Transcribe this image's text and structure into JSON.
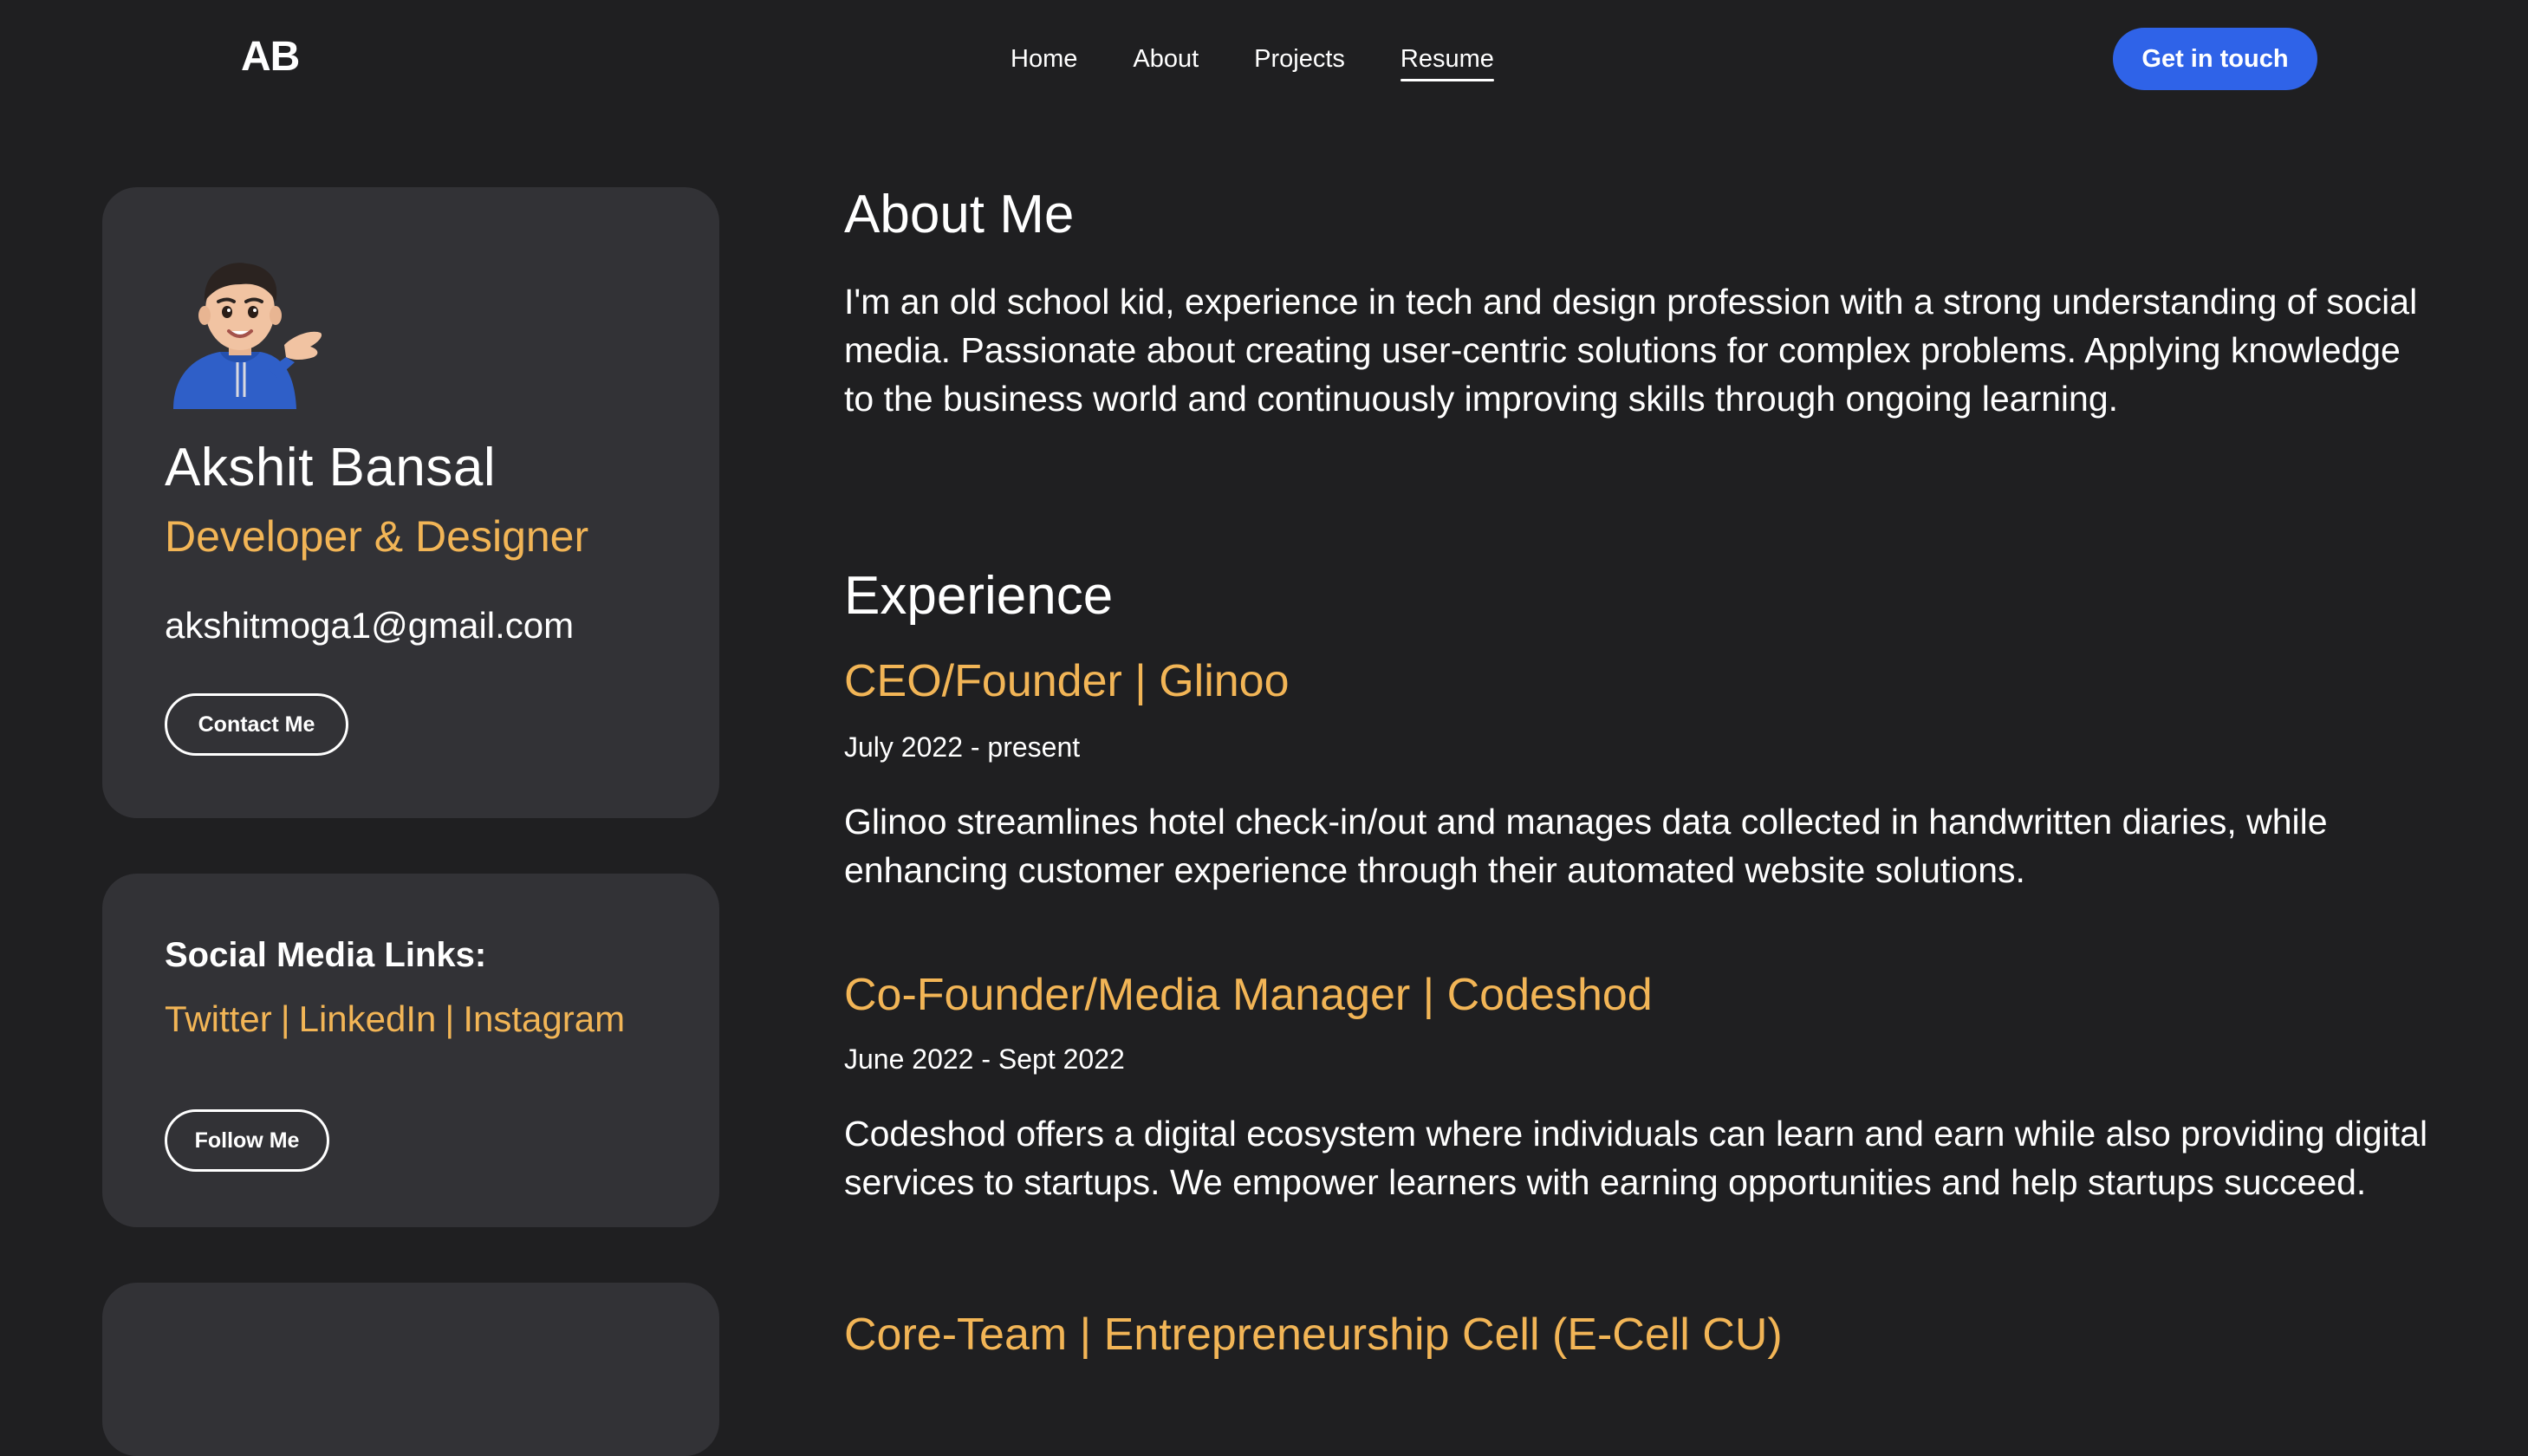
{
  "nav": {
    "logo": "AB",
    "links": [
      "Home",
      "About",
      "Projects",
      "Resume"
    ],
    "active": "Resume",
    "cta_label": "Get in touch"
  },
  "profile": {
    "avatar_icon": "memoji-avatar-icon",
    "name": "Akshit Bansal",
    "role": "Developer & Designer",
    "email": "akshitmoga1@gmail.com",
    "contact_label": "Contact Me"
  },
  "social": {
    "title": "Social Media Links:",
    "links": [
      "Twitter",
      "LinkedIn",
      "Instagram"
    ],
    "separator": "|",
    "follow_label": "Follow Me"
  },
  "about": {
    "heading": "About Me",
    "text": "I'm an old school kid, experience in tech and design profession with a strong understanding of social media. Passionate about creating user-centric solutions for complex problems. Applying knowledge to the business world and continuously improving skills through ongoing learning."
  },
  "experience": {
    "heading": "Experience",
    "jobs": [
      {
        "title": "CEO/Founder | Glinoo",
        "date": "July 2022 - present",
        "description": "Glinoo streamlines hotel check-in/out and manages data collected in handwritten diaries, while enhancing customer experience through their automated website solutions."
      },
      {
        "title": "Co-Founder/Media Manager |  Codeshod",
        "date": "June 2022 - Sept 2022",
        "description": "Codeshod offers a digital ecosystem where individuals can learn and earn while also providing digital services to startups. We empower learners with earning opportunities and help startups succeed."
      },
      {
        "title": "Core-Team | Entrepreneurship Cell (E-Cell CU)"
      }
    ]
  },
  "colors": {
    "background": "#1f1f21",
    "card": "#323236",
    "accent": "#f2b556",
    "cta": "#2f63e8"
  }
}
